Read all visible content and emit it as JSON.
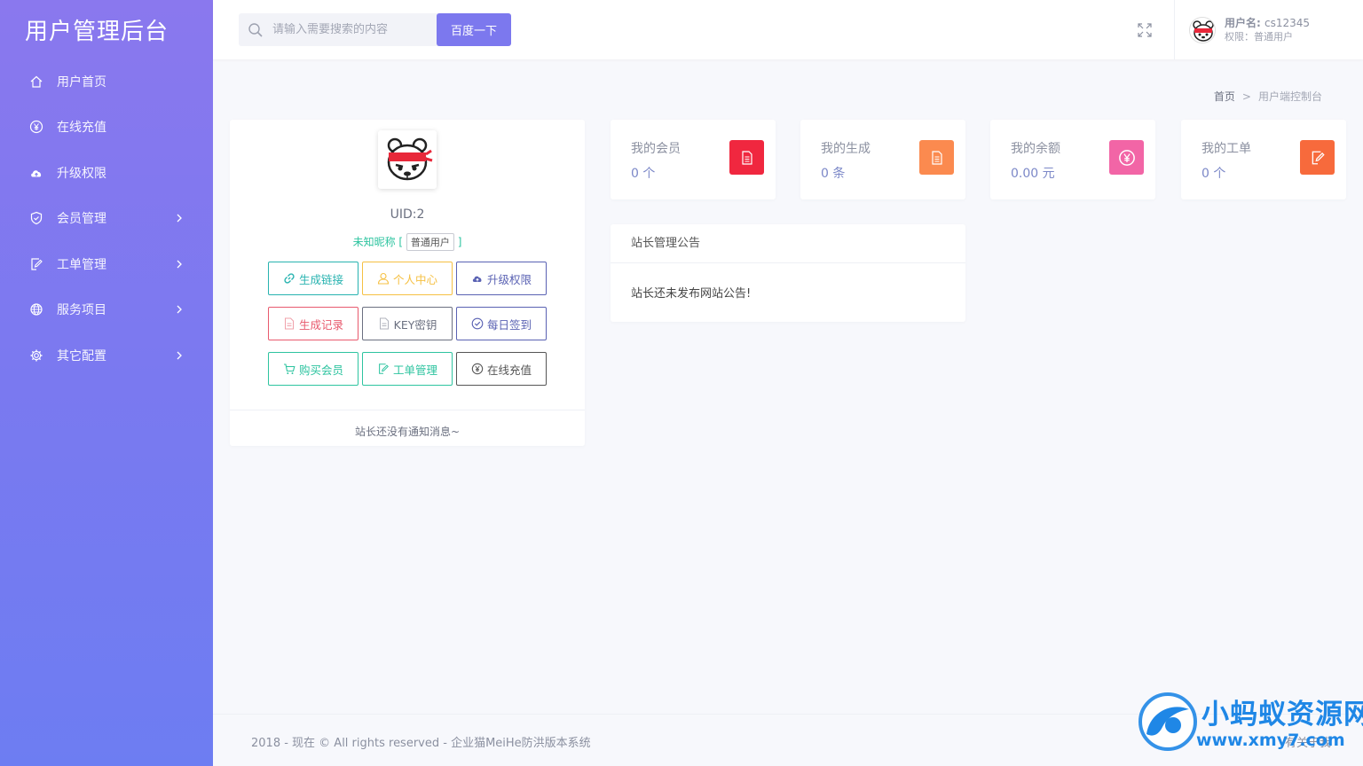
{
  "app": {
    "title": "用户管理后台"
  },
  "sidebar": {
    "items": [
      {
        "label": "用户首页",
        "icon": "home-icon",
        "expandable": false
      },
      {
        "label": "在线充值",
        "icon": "yen-circle-icon",
        "expandable": false
      },
      {
        "label": "升级权限",
        "icon": "cloud-upload-icon",
        "expandable": false
      },
      {
        "label": "会员管理",
        "icon": "shield-check-icon",
        "expandable": true
      },
      {
        "label": "工单管理",
        "icon": "edit-doc-icon",
        "expandable": true
      },
      {
        "label": "服务项目",
        "icon": "globe-icon",
        "expandable": true
      },
      {
        "label": "其它配置",
        "icon": "gear-icon",
        "expandable": true
      }
    ]
  },
  "header": {
    "search_placeholder": "请输入需要搜索的内容",
    "search_button": "百度一下",
    "user_name_label": "用户名:",
    "user_name": "cs12345",
    "user_role": "权限：普通用户"
  },
  "breadcrumb": {
    "home": "首页",
    "separator": ">",
    "current": "用户端控制台"
  },
  "profile": {
    "uid": "UID:2",
    "nickname": "未知昵称",
    "bracket_open": "[",
    "bracket_close": "]",
    "role_badge": "普通用户",
    "buttons": [
      {
        "label": "生成链接",
        "icon": "link-icon",
        "color": "#28b3b0"
      },
      {
        "label": "个人中心",
        "icon": "user-icon",
        "color": "#f5c043"
      },
      {
        "label": "升级权限",
        "icon": "cloud-upload-icon",
        "color": "#5a62b3"
      },
      {
        "label": "生成记录",
        "icon": "file-icon",
        "color": "#e85a6e"
      },
      {
        "label": "KEY密钥",
        "icon": "file-icon",
        "color": "#6b7080"
      },
      {
        "label": "每日签到",
        "icon": "check-circle-icon",
        "color": "#5a62b3"
      },
      {
        "label": "购买会员",
        "icon": "cart-icon",
        "color": "#2ec4a0"
      },
      {
        "label": "工单管理",
        "icon": "edit-doc-icon",
        "color": "#2ec4a0"
      },
      {
        "label": "在线充值",
        "icon": "yen-circle-icon",
        "color": "#555555"
      }
    ],
    "footer_message": "站长还没有通知消息~"
  },
  "stats": [
    {
      "label": "我的会员",
      "value": "0 个",
      "icon": "document-icon",
      "color": "#f0273f"
    },
    {
      "label": "我的生成",
      "value": "0 条",
      "icon": "document-icon",
      "color": "#fb8a4f"
    },
    {
      "label": "我的余额",
      "value": "0.00 元",
      "icon": "yen-circle-icon",
      "color": "#f265a6"
    },
    {
      "label": "我的工单",
      "value": "0 个",
      "icon": "edit-doc-icon",
      "color": "#f76a3c"
    }
  ],
  "notice": {
    "title": "站长管理公告",
    "body": "站长还未发布网站公告!"
  },
  "footer": {
    "copyright": "2018 - 现在 © All rights reserved - 企业猫MeiHe防洪版本系统",
    "right_text": "有关于我"
  },
  "watermark": {
    "line1": "小蚂蚁资源网",
    "line2": "www.xmy7.com"
  }
}
